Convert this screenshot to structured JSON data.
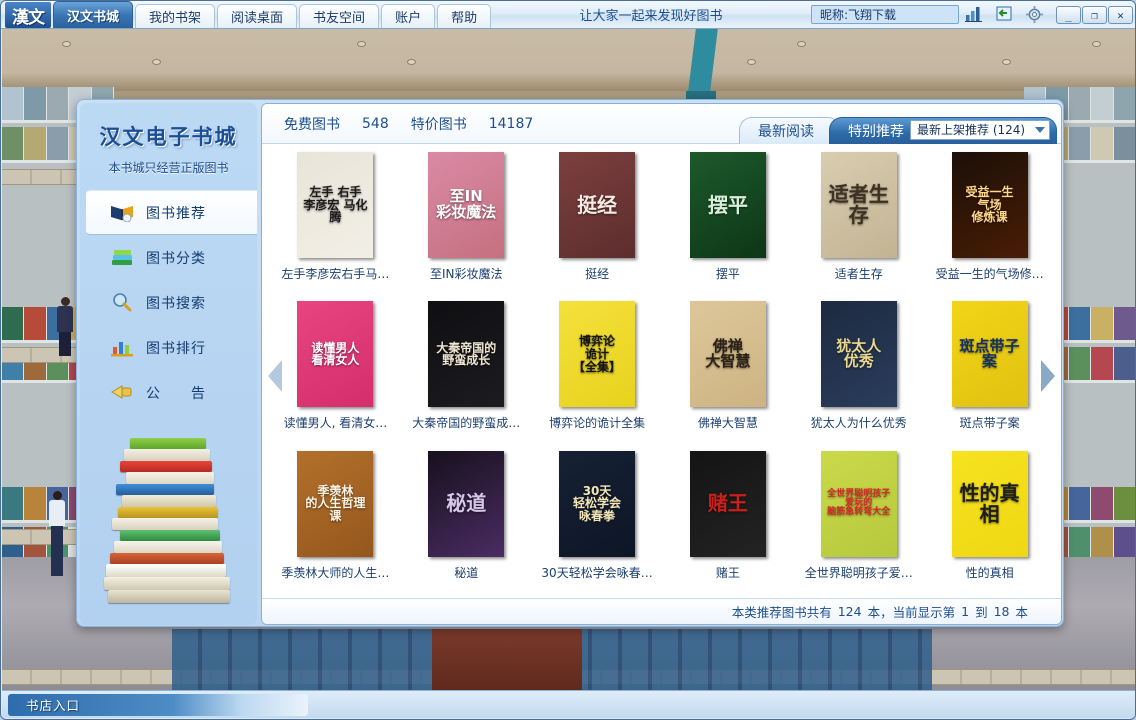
{
  "titlebar": {
    "logo": "漢文",
    "menu": [
      {
        "label": "汉文书城",
        "active": true
      },
      {
        "label": "我的书架",
        "active": false
      },
      {
        "label": "阅读桌面",
        "active": false
      },
      {
        "label": "书友空间",
        "active": false
      },
      {
        "label": "账户",
        "active": false
      },
      {
        "label": "帮助",
        "active": false
      }
    ],
    "slogan": "让大家一起来发现好图书",
    "nickname": "昵称:飞翔下载",
    "icons": [
      "chart-icon",
      "login-icon",
      "gear-icon"
    ],
    "window_buttons": [
      {
        "name": "minimize-button",
        "glyph": "_"
      },
      {
        "name": "maximize-button",
        "glyph": "❐"
      },
      {
        "name": "close-button",
        "glyph": "✕"
      }
    ]
  },
  "sidebar": {
    "brand": "汉文电子书城",
    "brand_sub": "本书城只经营正版图书",
    "items": [
      {
        "label": "图书推荐",
        "icon": "open-book-icon",
        "active": true
      },
      {
        "label": "图书分类",
        "icon": "stacked-books-icon",
        "active": false
      },
      {
        "label": "图书搜索",
        "icon": "magnifier-icon",
        "active": false
      },
      {
        "label": "图书排行",
        "icon": "bar-chart-icon",
        "active": false
      },
      {
        "label": "公　　告",
        "icon": "megaphone-icon",
        "active": false
      }
    ]
  },
  "content_header": {
    "free_label": "免费图书",
    "free_count": "548",
    "sale_label": "特价图书",
    "sale_count": "14187",
    "tab_latest": "最新阅读",
    "tab_special": "特别推荐",
    "select_value": "最新上架推荐 (124)"
  },
  "books": [
    {
      "title": "左手李彦宏右手马…",
      "cover_text": "左手 右手\n李彦宏 马化腾",
      "bg1": "#e8e4d8",
      "bg2": "#f2efe6",
      "accent": "#1b1b1b"
    },
    {
      "title": "至IN彩妆魔法",
      "cover_text": "至IN\n彩妆魔法",
      "bg1": "#d98aa6",
      "bg2": "#c6707f",
      "accent": "#ffffff"
    },
    {
      "title": "挺经",
      "cover_text": "挺经",
      "bg1": "#7c3f3f",
      "bg2": "#5d2d2d",
      "accent": "#f4ece2"
    },
    {
      "title": "摆平",
      "cover_text": "摆平",
      "bg1": "#1d5a2b",
      "bg2": "#0d3617",
      "accent": "#d8efd9"
    },
    {
      "title": "适者生存",
      "cover_text": "适者生存",
      "bg1": "#d9cdb1",
      "bg2": "#c2b492",
      "accent": "#3d3222"
    },
    {
      "title": "受益一生的气场修…",
      "cover_text": "受益一生\n气场\n修炼课",
      "bg1": "#1a0f08",
      "bg2": "#4a1d05",
      "accent": "#ffd98a"
    },
    {
      "title": "读懂男人, 看清女…",
      "cover_text": "读懂男人\n看清女人",
      "bg1": "#e8457f",
      "bg2": "#d42e6c",
      "accent": "#ffffff"
    },
    {
      "title": "大秦帝国的野蛮成…",
      "cover_text": "大秦帝国的野蛮成长",
      "bg1": "#0f0f12",
      "bg2": "#1c1c20",
      "accent": "#f0e6d2"
    },
    {
      "title": "博弈论的诡计全集",
      "cover_text": "博弈论\n诡计\n【全集】",
      "bg1": "#f4e13a",
      "bg2": "#e8d21f",
      "accent": "#141414"
    },
    {
      "title": "佛禅大智慧",
      "cover_text": "佛禅\n大智慧",
      "bg1": "#ddc79a",
      "bg2": "#cdb382",
      "accent": "#2b2116"
    },
    {
      "title": "犹太人为什么优秀",
      "cover_text": "犹太人\n优秀",
      "bg1": "#1d2a40",
      "bg2": "#2a3d5c",
      "accent": "#e9d88f"
    },
    {
      "title": "斑点带子案",
      "cover_text": "斑点带子案",
      "bg1": "#f2d517",
      "bg2": "#e0c210",
      "accent": "#14315e"
    },
    {
      "title": "季羡林大师的人生…",
      "cover_text": "季羡林\n的人生哲理课",
      "bg1": "#b3702c",
      "bg2": "#94571c",
      "accent": "#fdf4e4"
    },
    {
      "title": "秘道",
      "cover_text": "秘道",
      "bg1": "#17101c",
      "bg2": "#4a2c63",
      "accent": "#d8c6ea"
    },
    {
      "title": "30天轻松学会咏春…",
      "cover_text": "30天\n轻松学会\n咏春拳",
      "bg1": "#162135",
      "bg2": "#0d1626",
      "accent": "#f3e6b6"
    },
    {
      "title": "赌王",
      "cover_text": "赌王",
      "bg1": "#141414",
      "bg2": "#232323",
      "accent": "#c8201c"
    },
    {
      "title": "全世界聪明孩子爱…",
      "cover_text": "全世界聪明孩子爱玩的\n脑筋急转弯大全",
      "bg1": "#c9d94a",
      "bg2": "#b6c93c",
      "accent": "#d62828"
    },
    {
      "title": "性的真相",
      "cover_text": "性的真相",
      "bg1": "#f7e220",
      "bg2": "#efd812",
      "accent": "#1d1d1d"
    }
  ],
  "status": {
    "prefix": "本类推荐图书共有",
    "total": "124",
    "mid": "本，当前显示第",
    "from": "1",
    "to_word": "到",
    "to": "18",
    "suffix": "本"
  },
  "taskbar": {
    "button_label": "书店入口"
  },
  "colors": {
    "accent_blue": "#2b62a0",
    "panel_blue": "#bcd9f4",
    "text_blue": "#1d4f8f"
  }
}
